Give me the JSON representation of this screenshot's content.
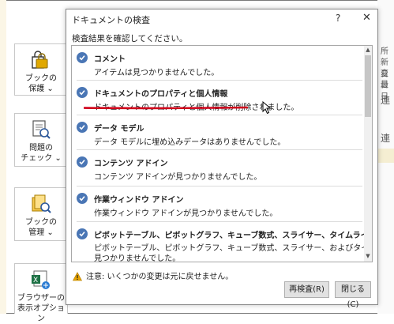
{
  "backstage": {
    "tiles": [
      {
        "label": "ブックの\n保護 ⌄",
        "icon": "lock-icon"
      },
      {
        "label": "問題の\nチェック ⌄",
        "icon": "inspect-icon"
      },
      {
        "label": "ブックの\n管理 ⌄",
        "icon": "manage-book-icon"
      },
      {
        "label": "ブラウザーの\n表示オプション",
        "icon": "browser-view-icon"
      }
    ],
    "right_fragments": [
      "所",
      "新日",
      "変日",
      "最日",
      "連",
      "連"
    ]
  },
  "dialog": {
    "title": "ドキュメントの検査",
    "help": "?",
    "close": "✕",
    "instruction": "検査結果を確認してください。",
    "items": [
      {
        "title": "コメント",
        "desc": [
          "アイテムは見つかりませんでした。"
        ]
      },
      {
        "title": "ドキュメントのプロパティと個人情報",
        "desc": [
          "ドキュメントのプロパティと個人情報が削除されました。"
        ]
      },
      {
        "title": "データ モデル",
        "desc": [
          "データ モデルに埋め込みデータはありませんでした。"
        ]
      },
      {
        "title": "コンテンツ アドイン",
        "desc": [
          "コンテンツ アドインが見つかりませんでした。"
        ]
      },
      {
        "title": "作業ウィンドウ アドイン",
        "desc": [
          "作業ウィンドウ アドインが見つかりませんでした。"
        ]
      },
      {
        "title": "ピボットテーブル、ピボットグラフ、キューブ数式、スライサー、タイムライン",
        "desc": [
          "ピボットテーブル、ピボットグラフ、キューブ数式、スライサー、およびタイムラインは",
          "見つかりませんでした。"
        ]
      }
    ],
    "warning": "注意: いくつかの変更は元に戻せません。",
    "recheck_label": "再検査(R)",
    "close_label": "閉じる(C)"
  },
  "colors": {
    "check": "#4a76b5",
    "underline": "#d0021b",
    "warning": "#e8a400"
  }
}
